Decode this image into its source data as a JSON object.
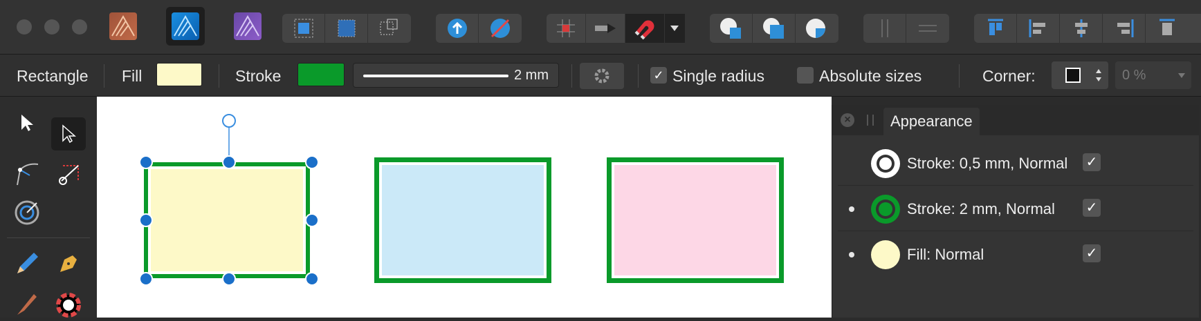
{
  "context_toolbar": {
    "tool_name": "Rectangle",
    "fill_label": "Fill",
    "fill_color": "#fdf9c8",
    "stroke_label": "Stroke",
    "stroke_color": "#0a9a2a",
    "stroke_width": "2 mm",
    "single_radius_label": "Single radius",
    "single_radius_checked": "✓",
    "absolute_sizes_label": "Absolute sizes",
    "corner_label": "Corner:",
    "corner_percent": "0 %"
  },
  "canvas": {
    "shapes": [
      {
        "name": "yellow-rectangle",
        "fill": "#fdf9c8",
        "stroke": "#0a9a2a"
      },
      {
        "name": "blue-rectangle",
        "fill": "#cbe9f8",
        "stroke": "#0a9a2a"
      },
      {
        "name": "pink-rectangle",
        "fill": "#fdd7e6",
        "stroke": "#0a9a2a"
      }
    ]
  },
  "appearance_panel": {
    "title": "Appearance",
    "rows": [
      {
        "label": "Stroke: 0,5 mm, Normal",
        "check": "✓"
      },
      {
        "label": "Stroke: 2 mm, Normal",
        "check": "✓"
      },
      {
        "label": "Fill: Normal",
        "check": "✓"
      }
    ]
  },
  "colors": {
    "accent_blue": "#1a6fc9",
    "toolbar_bg": "#333333",
    "panel_bg": "#343434"
  }
}
